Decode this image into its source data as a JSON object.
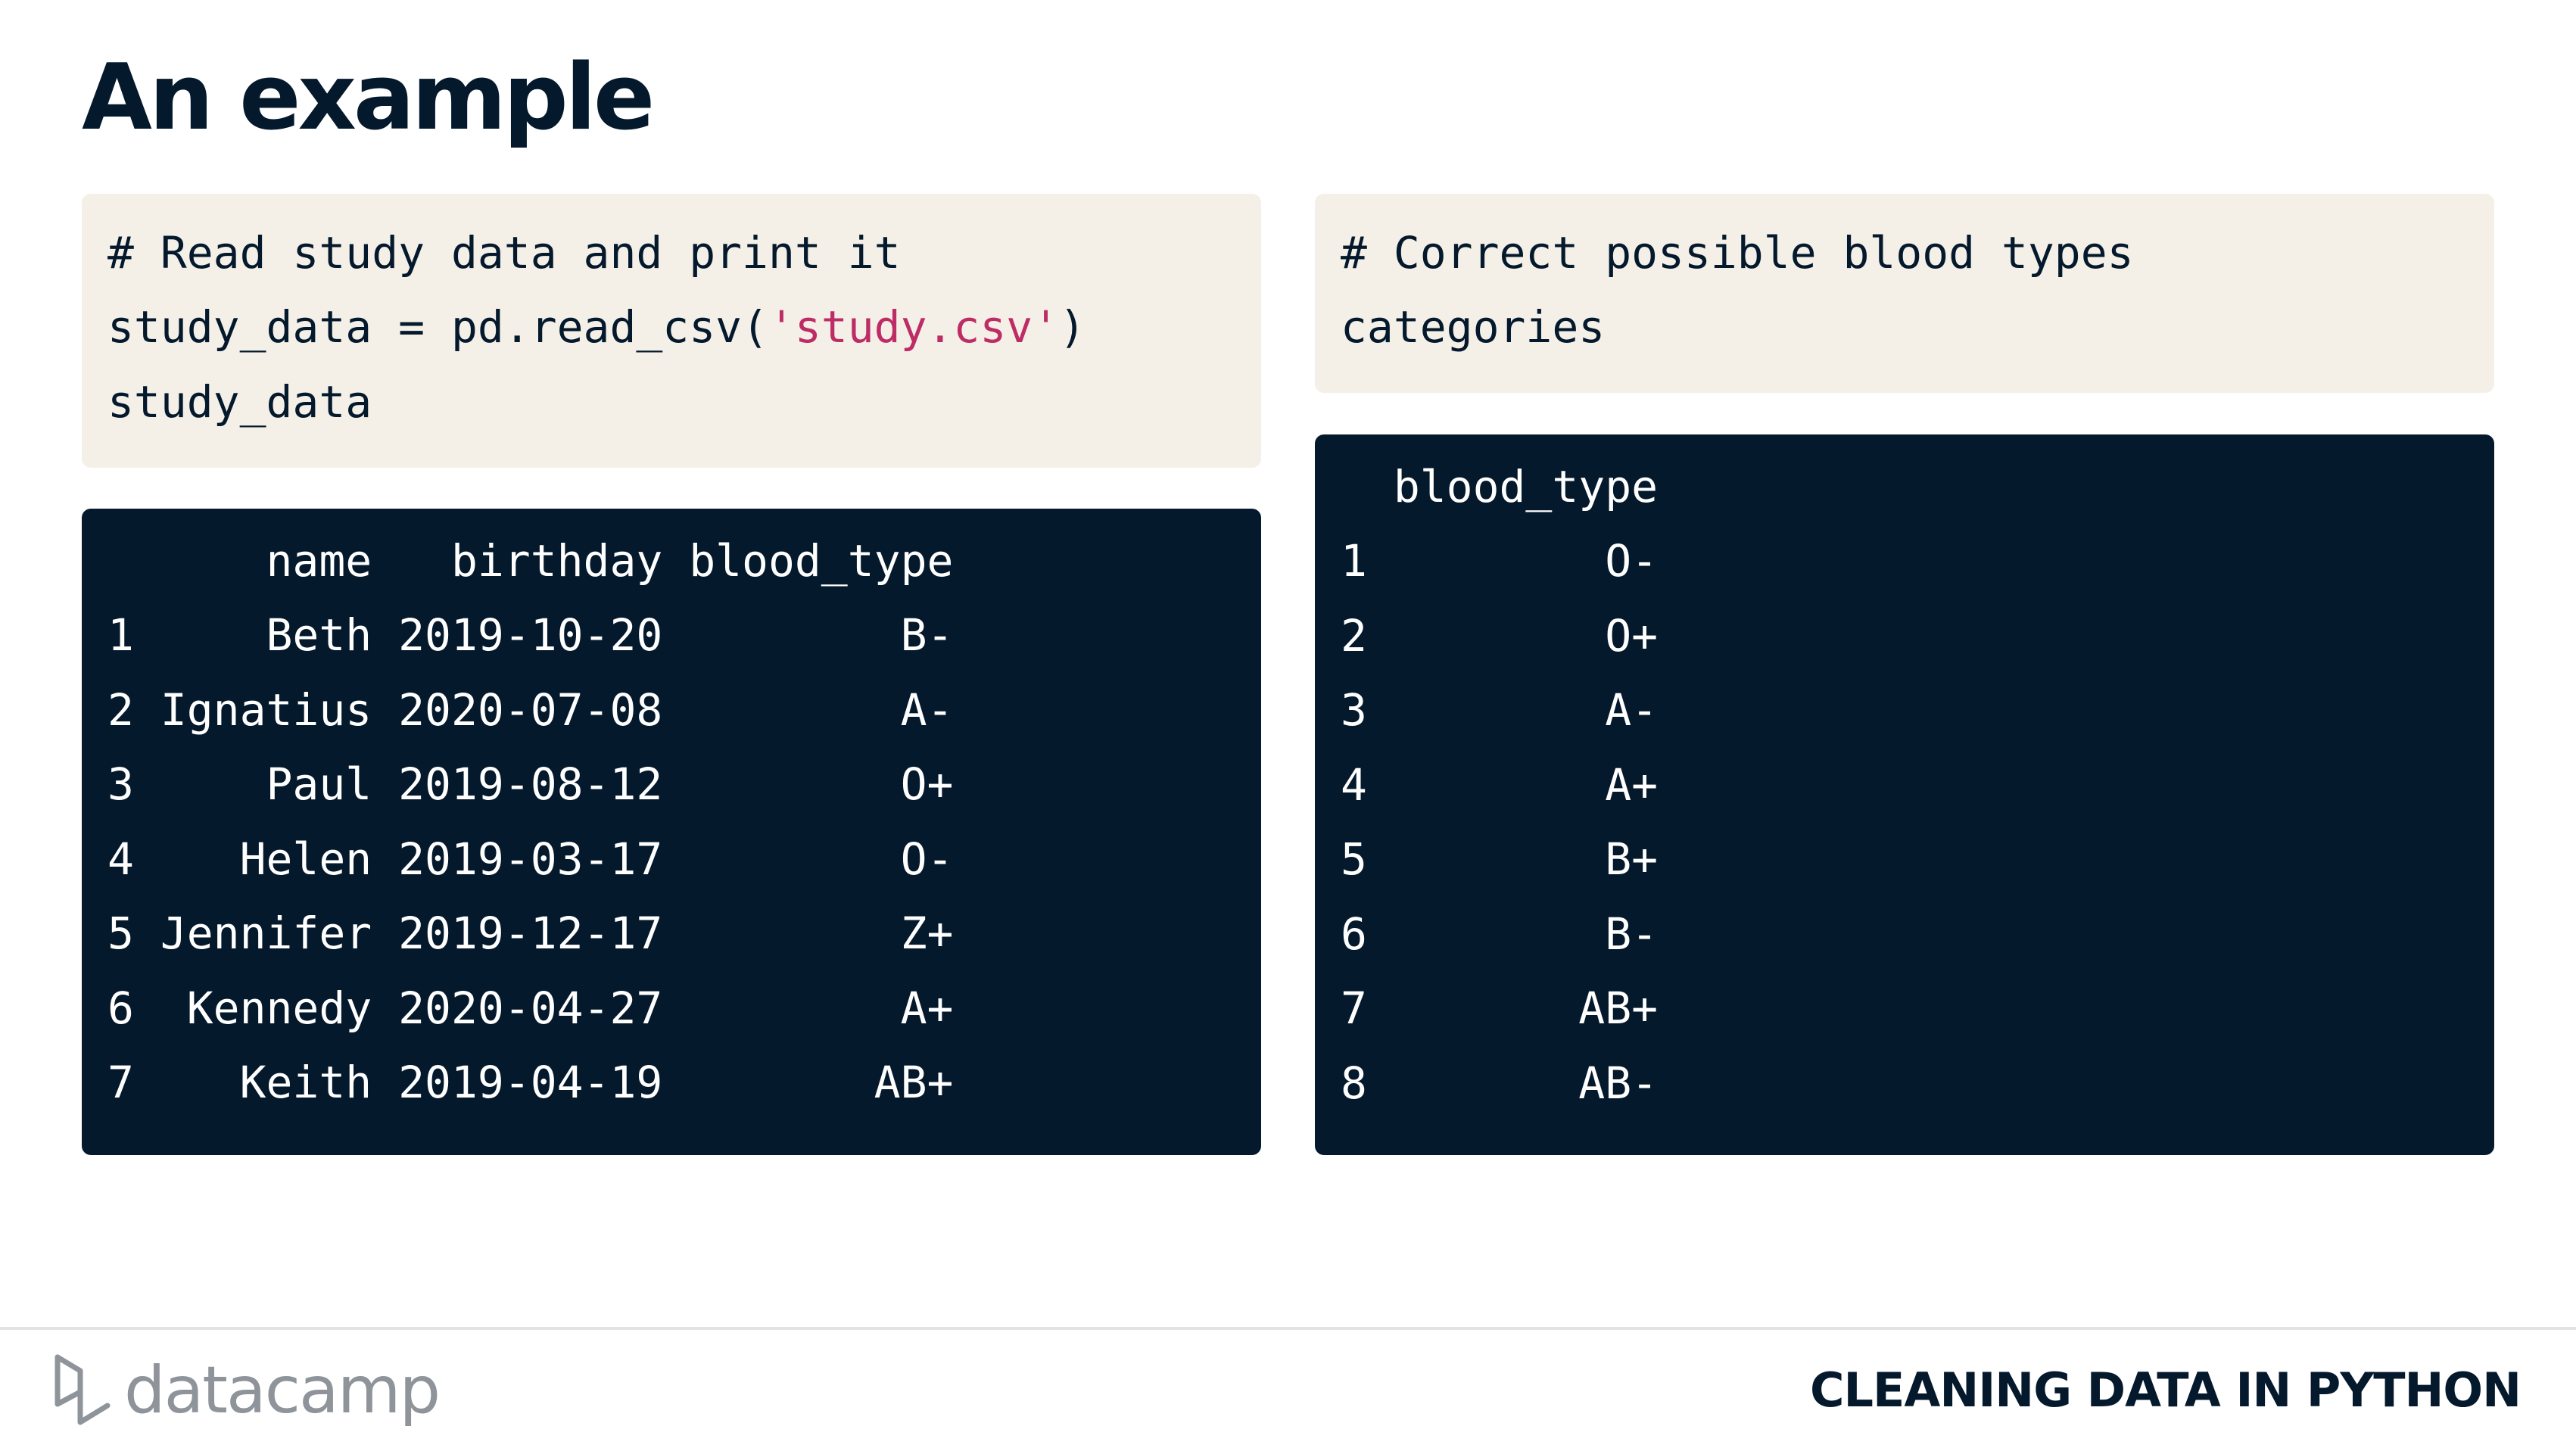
{
  "slide": {
    "title": "An example"
  },
  "code_left": {
    "comment": "# Read study data and print it",
    "line2_prefix": "study_data = pd.read_csv(",
    "line2_string": "'study.csv'",
    "line2_suffix": ")",
    "line3": "study_data"
  },
  "output_left": {
    "columns": [
      "name",
      "birthday",
      "blood_type"
    ],
    "header_line": "      name   birthday blood_type",
    "rows": [
      {
        "index": "1",
        "name": "Beth",
        "birthday": "2019-10-20",
        "blood_type": "B-",
        "line": "1     Beth 2019-10-20         B-"
      },
      {
        "index": "2",
        "name": "Ignatius",
        "birthday": "2020-07-08",
        "blood_type": "A-",
        "line": "2 Ignatius 2020-07-08         A-"
      },
      {
        "index": "3",
        "name": "Paul",
        "birthday": "2019-08-12",
        "blood_type": "O+",
        "line": "3     Paul 2019-08-12         O+"
      },
      {
        "index": "4",
        "name": "Helen",
        "birthday": "2019-03-17",
        "blood_type": "O-",
        "line": "4    Helen 2019-03-17         O-"
      },
      {
        "index": "5",
        "name": "Jennifer",
        "birthday": "2019-12-17",
        "blood_type": "Z+",
        "line": "5 Jennifer 2019-12-17         Z+"
      },
      {
        "index": "6",
        "name": "Kennedy",
        "birthday": "2020-04-27",
        "blood_type": "A+",
        "line": "6  Kennedy 2020-04-27         A+"
      },
      {
        "index": "7",
        "name": "Keith",
        "birthday": "2019-04-19",
        "blood_type": "AB+",
        "line": "7    Keith 2019-04-19        AB+"
      }
    ]
  },
  "code_right": {
    "comment": "# Correct possible blood types",
    "line2": "categories"
  },
  "output_right": {
    "columns": [
      "blood_type"
    ],
    "header_line": "  blood_type",
    "rows": [
      {
        "index": "1",
        "blood_type": "O-",
        "line": "1         O-"
      },
      {
        "index": "2",
        "blood_type": "O+",
        "line": "2         O+"
      },
      {
        "index": "3",
        "blood_type": "A-",
        "line": "3         A-"
      },
      {
        "index": "4",
        "blood_type": "A+",
        "line": "4         A+"
      },
      {
        "index": "5",
        "blood_type": "B+",
        "line": "5         B+"
      },
      {
        "index": "6",
        "blood_type": "B-",
        "line": "6         B-"
      },
      {
        "index": "7",
        "blood_type": "AB+",
        "line": "7        AB+"
      },
      {
        "index": "8",
        "blood_type": "AB-",
        "line": "8        AB-"
      }
    ]
  },
  "footer": {
    "logo_text": "datacamp",
    "course_title": "CLEANING DATA IN PYTHON"
  },
  "colors": {
    "heading": "#05192d",
    "code_background": "#f4f0e8",
    "output_background": "#05192d",
    "comment": "#1a8a13",
    "string": "#be2c66",
    "logo": "#8f949b"
  }
}
